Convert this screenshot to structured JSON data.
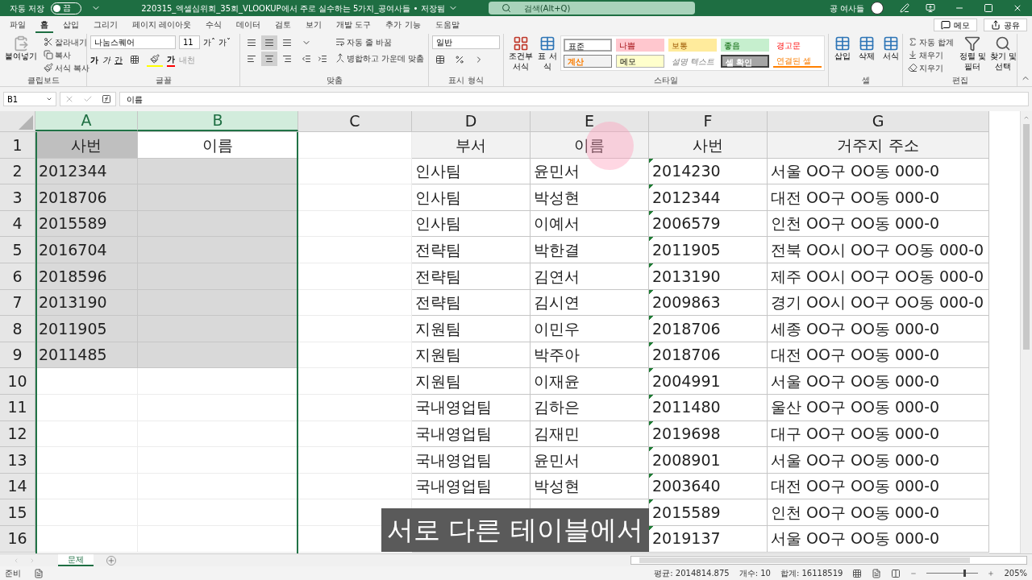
{
  "title_bar": {
    "autosave_label": "자동 저장",
    "autosave": {
      "on": false,
      "text": "끔"
    },
    "title": "220315_엑셀심위회_35회_VLOOKUP에서 주로 실수하는 5가지_공여사들 • 저장됨",
    "search_placeholder": "검색(Alt+Q)",
    "user": "공 여사들"
  },
  "menu_tabs": [
    {
      "label": "파일",
      "selected": false
    },
    {
      "label": "홈",
      "selected": true
    },
    {
      "label": "삽입",
      "selected": false
    },
    {
      "label": "그리기",
      "selected": false
    },
    {
      "label": "페이지 레이아웃",
      "selected": false
    },
    {
      "label": "수식",
      "selected": false
    },
    {
      "label": "데이터",
      "selected": false
    },
    {
      "label": "검토",
      "selected": false
    },
    {
      "label": "보기",
      "selected": false
    },
    {
      "label": "개발 도구",
      "selected": false
    },
    {
      "label": "추가 기능",
      "selected": false
    },
    {
      "label": "도움말",
      "selected": false
    }
  ],
  "ribbon_actions": [
    "메모",
    "공유"
  ],
  "ribbon": {
    "clipboard": {
      "label": "클립보드",
      "paste": "붙여넣기",
      "cut": "잘라내기",
      "copy": "복사",
      "format_painter": "서식 복사"
    },
    "font": {
      "label": "글꼴",
      "name": "나눔스퀘어",
      "size": "11",
      "grow": "가ˆ",
      "shrink": "가ˇ",
      "bold": "가",
      "italic": "가",
      "underline": "간",
      "font_color": "가",
      "phonetic": "내천"
    },
    "alignment": {
      "label": "맞춤",
      "wrap": "자동 줄 바꿈",
      "merge": "병합하고 가운데 맞춤"
    },
    "number": {
      "label": "표시 형식",
      "format": "일반"
    },
    "styles": {
      "label": "스타일",
      "conditional": "조건부 서식",
      "table": "표 서식",
      "cells": [
        {
          "label": "표준",
          "kind": "standard"
        },
        {
          "label": "나쁨",
          "kind": "bad"
        },
        {
          "label": "보통",
          "kind": "neutral"
        },
        {
          "label": "좋음",
          "kind": "good"
        },
        {
          "label": "경고문",
          "kind": "warning"
        },
        {
          "label": "계산",
          "kind": "calculation"
        },
        {
          "label": "메모",
          "kind": "note"
        },
        {
          "label": "설명 텍스트",
          "kind": "explanatory"
        },
        {
          "label": "셀 확인",
          "kind": "check"
        },
        {
          "label": "연결된 셀",
          "kind": "linked"
        }
      ]
    },
    "cells": {
      "label": "셀",
      "buttons": [
        "삽입",
        "삭제",
        "서식"
      ]
    },
    "editing": {
      "label": "편집",
      "autosum": "자동 합계",
      "fill": "채우기",
      "clear": "지우기",
      "sort": "정렬 및 필터",
      "find": "찾기 및 선택"
    }
  },
  "formula_bar": {
    "name_box": "B1",
    "formula": "이름"
  },
  "sheet": {
    "columns": [
      {
        "label": "A",
        "selected": true
      },
      {
        "label": "B",
        "selected": true
      },
      {
        "label": "C",
        "selected": false
      },
      {
        "label": "D",
        "selected": false
      },
      {
        "label": "E",
        "selected": false
      },
      {
        "label": "F",
        "selected": false
      },
      {
        "label": "G",
        "selected": false
      }
    ],
    "rows": [
      {
        "number": "1",
        "selected": true,
        "header": true,
        "a": "사번",
        "b": "이름",
        "d": "부서",
        "e": "이름",
        "f": "사번",
        "g": "거주지 주소"
      },
      {
        "number": "2",
        "selected": true,
        "a": "2012344",
        "d": "인사팀",
        "e": "윤민서",
        "f": "2014230",
        "g": "서울 OO구 OO동 000-0"
      },
      {
        "number": "3",
        "selected": true,
        "a": "2018706",
        "d": "인사팀",
        "e": "박성현",
        "f": "2012344",
        "g": "대전 OO구 OO동 000-0"
      },
      {
        "number": "4",
        "selected": true,
        "a": "2015589",
        "d": "인사팀",
        "e": "이예서",
        "f": "2006579",
        "g": "인천 OO구 OO동 000-0"
      },
      {
        "number": "5",
        "selected": true,
        "a": "2016704",
        "d": "전략팀",
        "e": "박한결",
        "f": "2011905",
        "g": "전북 OO시 OO구 OO동 000-0"
      },
      {
        "number": "6",
        "selected": true,
        "a": "2018596",
        "d": "전략팀",
        "e": "김연서",
        "f": "2013190",
        "g": "제주 OO시 OO구 OO동 000-0"
      },
      {
        "number": "7",
        "selected": true,
        "a": "2013190",
        "d": "전략팀",
        "e": "김시연",
        "f": "2009863",
        "g": "경기 OO시 OO구 OO동 000-0"
      },
      {
        "number": "8",
        "selected": true,
        "a": "2011905",
        "d": "지원팀",
        "e": "이민우",
        "f": "2018706",
        "g": "세종 OO구 OO동 000-0"
      },
      {
        "number": "9",
        "selected": true,
        "a": "2011485",
        "d": "지원팀",
        "e": "박주아",
        "f": "2018706",
        "g": "대전 OO구 OO동 000-0"
      },
      {
        "number": "10",
        "selected": false,
        "d": "지원팀",
        "e": "이재윤",
        "f": "2004991",
        "g": "서울 OO구 OO동 000-0"
      },
      {
        "number": "11",
        "selected": false,
        "d": "국내영업팀",
        "e": "김하은",
        "f": "2011480",
        "g": "울산 OO구 OO동 000-0"
      },
      {
        "number": "12",
        "selected": false,
        "d": "국내영업팀",
        "e": "김재민",
        "f": "2019698",
        "g": "대구 OO구 OO동 000-0"
      },
      {
        "number": "13",
        "selected": false,
        "d": "국내영업팀",
        "e": "윤민서",
        "f": "2008901",
        "g": "서울 OO구 OO동 000-0"
      },
      {
        "number": "14",
        "selected": false,
        "d": "국내영업팀",
        "e": "박성현",
        "f": "2003640",
        "g": "대전 OO구 OO동 000-0"
      },
      {
        "number": "15",
        "selected": false,
        "f": "2015589",
        "g": "인천 OO구 OO동 000-0"
      },
      {
        "number": "16",
        "selected": false,
        "f": "2019137",
        "g": "서울 OO구 OO동 000-0"
      }
    ]
  },
  "subtitle": "서로 다른 테이블에서",
  "sheet_tabs": [
    {
      "label": "문제",
      "selected": true
    }
  ],
  "status_bar": {
    "ready": "준비",
    "stats": [
      "평균: 2014814.875",
      "개수: 10",
      "합계: 16118519"
    ],
    "zoom": {
      "level": 0.72,
      "text": "205%"
    }
  }
}
